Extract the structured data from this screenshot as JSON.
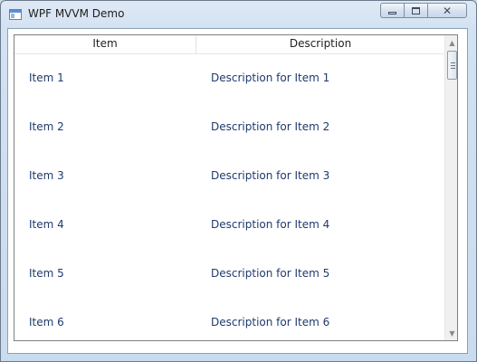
{
  "window": {
    "title": "WPF MVVM Demo",
    "icon": "app-window-icon",
    "controls": [
      "minimize-icon",
      "maximize-icon",
      "close-icon"
    ]
  },
  "list": {
    "columns": [
      "Item",
      "Description"
    ],
    "rows": [
      {
        "item": "Item 1",
        "description": "Description for Item 1"
      },
      {
        "item": "Item 2",
        "description": "Description for Item 2"
      },
      {
        "item": "Item 3",
        "description": "Description for Item 3"
      },
      {
        "item": "Item 4",
        "description": "Description for Item 4"
      },
      {
        "item": "Item 5",
        "description": "Description for Item 5"
      },
      {
        "item": "Item 6",
        "description": "Description for Item 6"
      }
    ]
  },
  "colors": {
    "cell_text": "#1f3a6e",
    "title_text": "#1e1e1e"
  }
}
